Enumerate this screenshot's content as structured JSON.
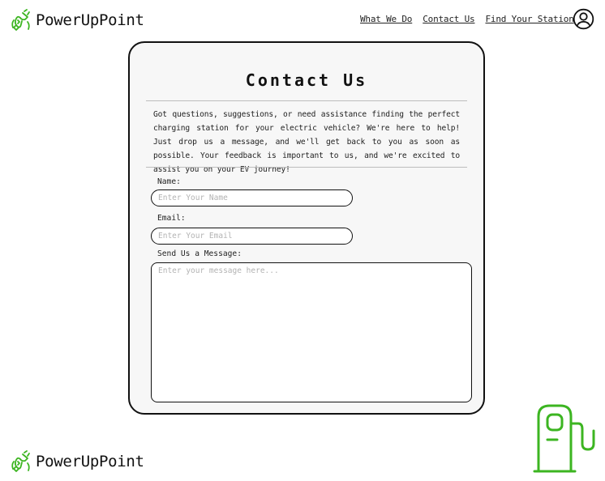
{
  "header": {
    "brand_name": "PowerUpPoint",
    "nav": [
      {
        "label": "What We Do"
      },
      {
        "label": "Contact Us"
      },
      {
        "label": "Find Your Station"
      }
    ],
    "account_icon": "user-circle-icon"
  },
  "contact_card": {
    "title": "Contact Us",
    "intro": "Got questions, suggestions, or need assistance finding the perfect charging station for your electric vehicle? We're here to help! Just drop us a message, and we'll get back to you as soon as possible. Your feedback is important to us, and we're excited to assist you on your EV journey!",
    "name_field": {
      "label": "Name:",
      "value": "",
      "placeholder": "Enter Your Name"
    },
    "email_field": {
      "label": "Email:",
      "value": "",
      "placeholder": "Enter Your Email"
    },
    "message_field": {
      "label": "Send Us a Message:",
      "value": "",
      "placeholder": "Enter your message here..."
    }
  },
  "footer": {
    "brand_name": "PowerUpPoint"
  },
  "icons": {
    "brand_logo": "plug-cord-icon",
    "decoration": "charging-station-icon"
  },
  "colors": {
    "accent_green": "#3cb521",
    "card_background": "#f7f7f7",
    "border": "#111111"
  }
}
